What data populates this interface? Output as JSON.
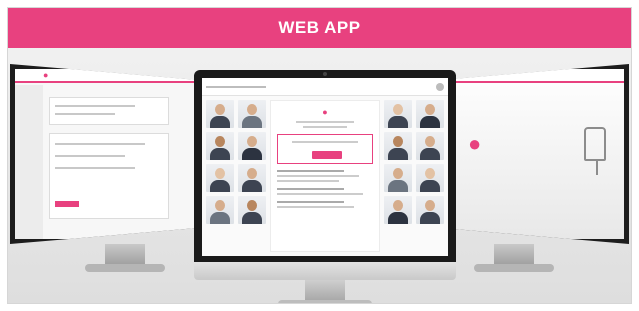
{
  "banner": {
    "title": "WEB APP"
  },
  "colors": {
    "brand": "#e8417f"
  },
  "icons": {
    "chair": "chair-icon"
  }
}
